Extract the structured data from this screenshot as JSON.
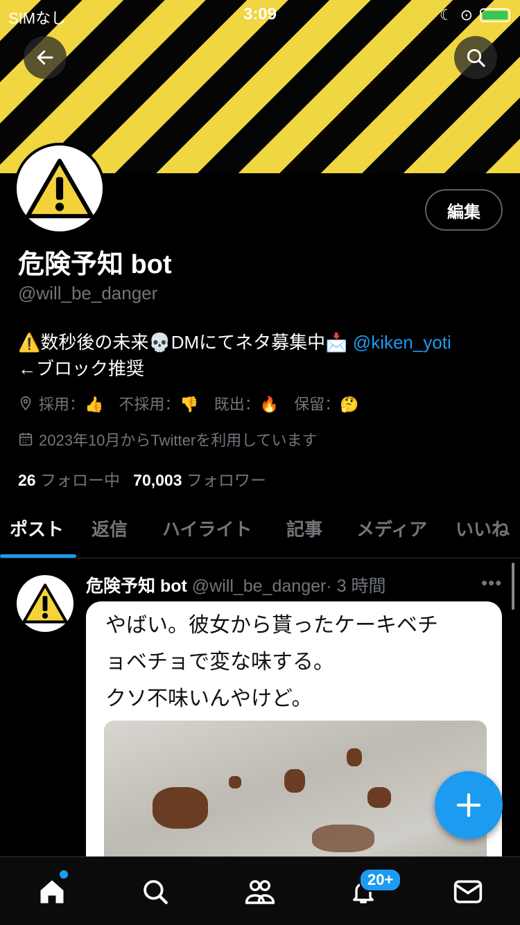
{
  "status_bar": {
    "carrier": "SIMなし",
    "time": "3:09"
  },
  "profile": {
    "edit_label": "編集",
    "display_name": "危険予知 bot",
    "handle": "@will_be_danger",
    "bio_line1_text": "⚠️数秒後の未来💀DMにてネタ募集中📩",
    "bio_mention": "@kiken_yoti",
    "bio_line2": "←ブロック推奨",
    "location_text": "採用：👍　不採用：👎　既出：🔥　保留：🤔",
    "joined": "2023年10月からTwitterを利用しています",
    "following_count": "26",
    "following_label": "フォロー中",
    "followers_count": "70,003",
    "followers_label": "フォロワー"
  },
  "tabs": [
    {
      "label": "ポスト"
    },
    {
      "label": "返信"
    },
    {
      "label": "ハイライト"
    },
    {
      "label": "記事"
    },
    {
      "label": "メディア"
    },
    {
      "label": "いいね"
    }
  ],
  "tweet": {
    "name": "危険予知 bot",
    "handle": "@will_be_danger",
    "time": "· 3 時間",
    "more": "•••",
    "text": "やばい。彼女から貰ったケーキベチ\nョベチョで変な味する。\nクソ不味いんやけど。"
  },
  "bottom_nav": {
    "notification_badge": "20+"
  },
  "colors": {
    "accent": "#1d9bf0",
    "banner_yellow": "#f0d640",
    "background": "#000000"
  }
}
